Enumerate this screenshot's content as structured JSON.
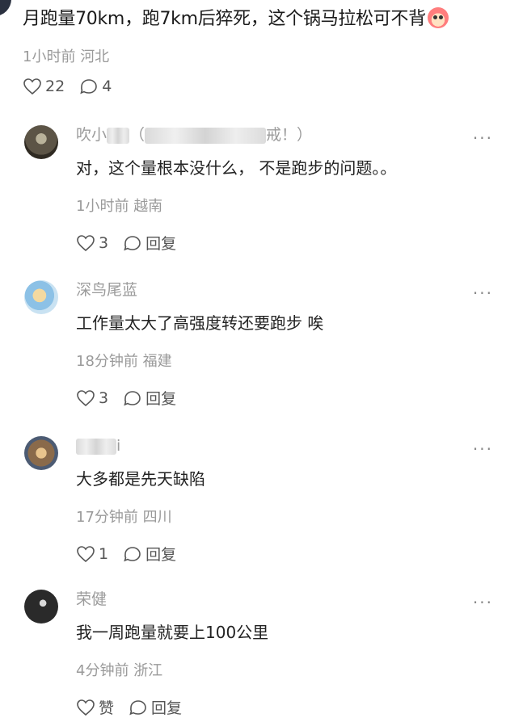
{
  "main": {
    "text": "月跑量70km，跑7km后猝死，这个锅马拉松可不背",
    "emoji_icon": "clown-face-icon",
    "time": "1小时前",
    "location": "河北",
    "likes": "22",
    "comments": "4"
  },
  "replies": [
    {
      "name": "吹小",
      "name_suffix": "（",
      "name_tail": "戒！）",
      "text": "对，这个量根本没什么， 不是跑步的问题。。",
      "time": "1小时前",
      "location": "越南",
      "likes": "3",
      "reply_label": "回复"
    },
    {
      "name": "深鸟尾蓝",
      "text": "工作量太大了高强度转还要跑步 唉",
      "time": "18分钟前",
      "location": "福建",
      "likes": "3",
      "reply_label": "回复"
    },
    {
      "name": "i",
      "text": "大多都是先天缺陷",
      "time": "17分钟前",
      "location": "四川",
      "likes": "1",
      "reply_label": "回复"
    },
    {
      "name": "荣健",
      "text": "我一周跑量就要上100公里",
      "time": "4分钟前",
      "location": "浙江",
      "likes": "赞",
      "reply_label": "回复"
    }
  ],
  "more_label": "···",
  "colors": {
    "text": "#222222",
    "meta": "#9a9a9a",
    "icon": "#555555"
  }
}
